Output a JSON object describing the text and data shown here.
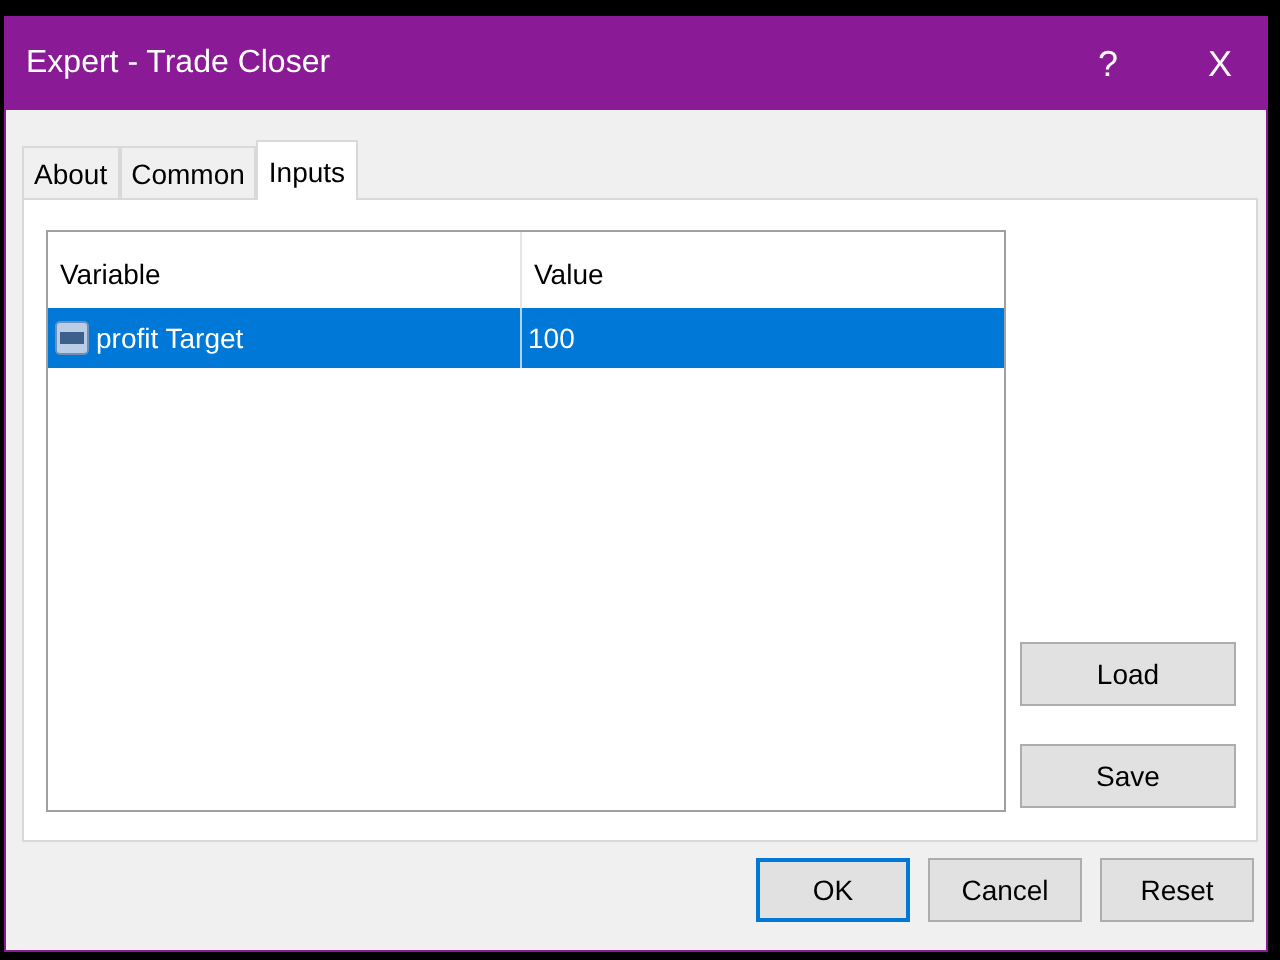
{
  "window": {
    "title": "Expert - Trade Closer",
    "help": "?",
    "close": "X"
  },
  "tabs": [
    {
      "label": "About",
      "selected": false
    },
    {
      "label": "Common",
      "selected": false
    },
    {
      "label": "Inputs",
      "selected": true
    }
  ],
  "table": {
    "columns": [
      "Variable",
      "Value"
    ],
    "rows": [
      {
        "variable": "profit Target",
        "value": "100",
        "selected": true
      }
    ]
  },
  "side_buttons": [
    "Load",
    "Save"
  ],
  "buttons": [
    {
      "label": "OK",
      "default": true
    },
    {
      "label": "Cancel",
      "default": false
    },
    {
      "label": "Reset",
      "default": false
    }
  ]
}
